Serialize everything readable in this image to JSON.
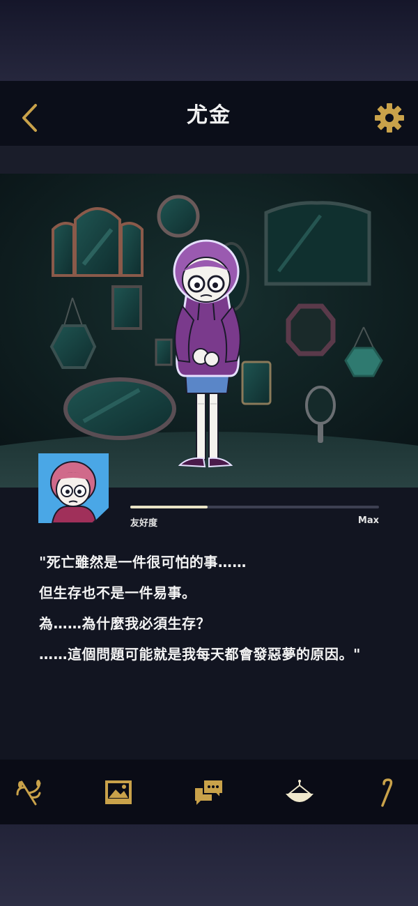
{
  "header": {
    "title": "尤金"
  },
  "friendship": {
    "label": "友好度",
    "max_label": "Max",
    "progress_fraction": 0.31
  },
  "quote": {
    "lines": [
      "\"死亡雖然是一件很可怕的事……",
      "但生存也不是一件易事。",
      "為……為什麼我必須生存？",
      "……這個問題可能就是我每天都會發惡夢的原因。\""
    ]
  },
  "tabs": [
    {
      "icon": "branch-icon"
    },
    {
      "icon": "image-icon"
    },
    {
      "icon": "chat-icon"
    },
    {
      "icon": "fan-icon"
    },
    {
      "icon": "cane-icon"
    }
  ],
  "colors": {
    "accent_gold": "#c9a24a",
    "header_bg": "#0b0e19",
    "panel_bg": "#121521",
    "character_purple": "#7a3a8c"
  }
}
